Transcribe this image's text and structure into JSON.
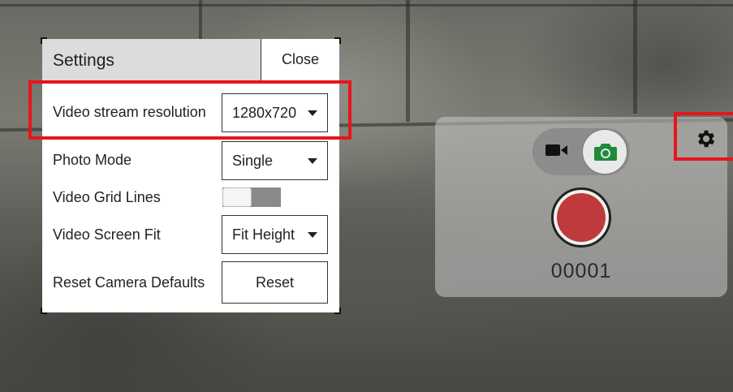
{
  "settings": {
    "title": "Settings",
    "close_label": "Close",
    "rows": [
      {
        "label": "Video stream resolution",
        "value": "1280x720"
      },
      {
        "label": "Photo Mode",
        "value": "Single"
      },
      {
        "label": "Video Grid Lines",
        "toggle_on": false
      },
      {
        "label": "Video Screen Fit",
        "value": "Fit Height"
      },
      {
        "label": "Reset Camera Defaults",
        "button_label": "Reset"
      }
    ]
  },
  "camera": {
    "mode_options": [
      "video",
      "photo"
    ],
    "selected_mode": "photo",
    "counter": "00001"
  },
  "icons": {
    "video": "video-camera-icon",
    "photo": "photo-camera-icon",
    "settings": "gear-icon",
    "dropdown": "caret-down-icon"
  },
  "colors": {
    "highlight": "#e8141c",
    "shutter": "#bf3b3b",
    "photo_icon": "#1f8a3a",
    "panel_header": "#dcdcdc"
  }
}
